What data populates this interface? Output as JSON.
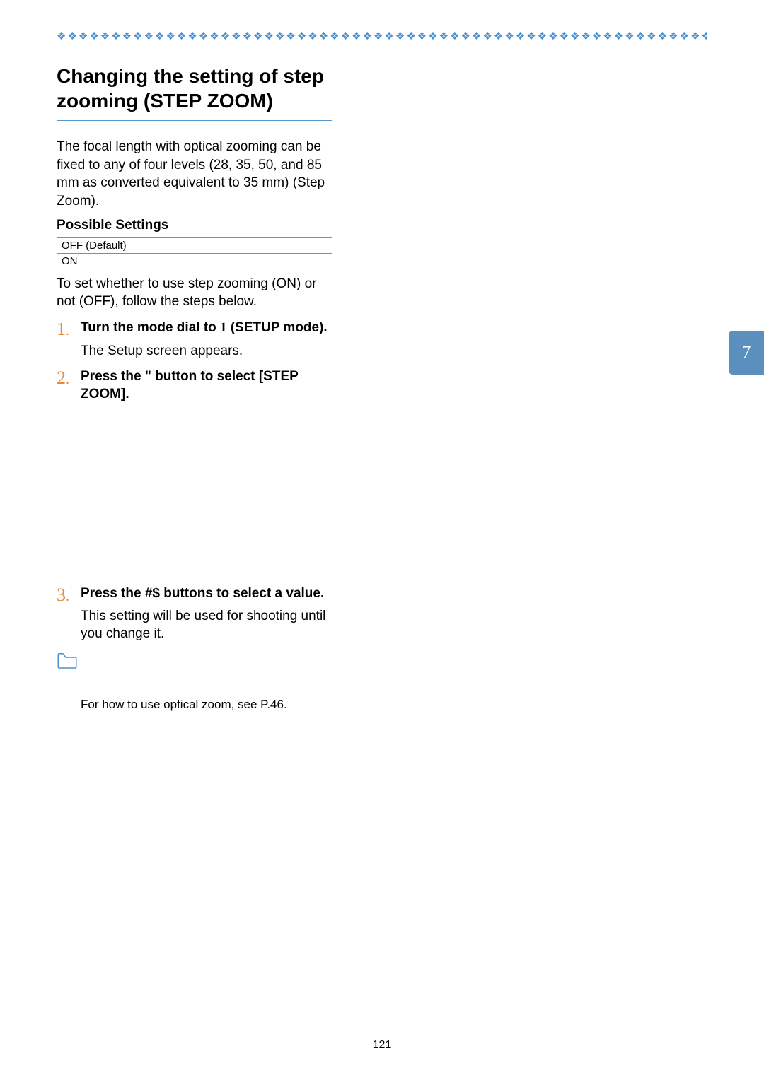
{
  "title": "Changing the setting of step zooming (STEP ZOOM)",
  "intro": "The focal length with optical zooming can be fixed to any of four levels (28, 35, 50, and 85 mm as converted equivalent to 35 mm) (Step Zoom).",
  "possibleSettingsLabel": "Possible Settings",
  "settings": [
    "OFF (Default)",
    "ON"
  ],
  "afterTable": "To set whether to use step zooming (ON) or not (OFF),  follow the steps below.",
  "steps": [
    {
      "num": "1",
      "dot": ".",
      "title_parts": [
        "Turn the mode dial to ",
        "1",
        " (SETUP mode)."
      ],
      "desc": "The Setup screen appears."
    },
    {
      "num": "2",
      "dot": ".",
      "title": "Press the \"   button to select [STEP ZOOM]."
    },
    {
      "num": "3",
      "dot": ".",
      "title": "Press the #$   buttons to select a value.",
      "desc": "This setting will be used for shooting until you change it."
    }
  ],
  "noteText": "For how to use optical zoom, see P.46.",
  "sideTab": "7",
  "pageNumber": "121"
}
